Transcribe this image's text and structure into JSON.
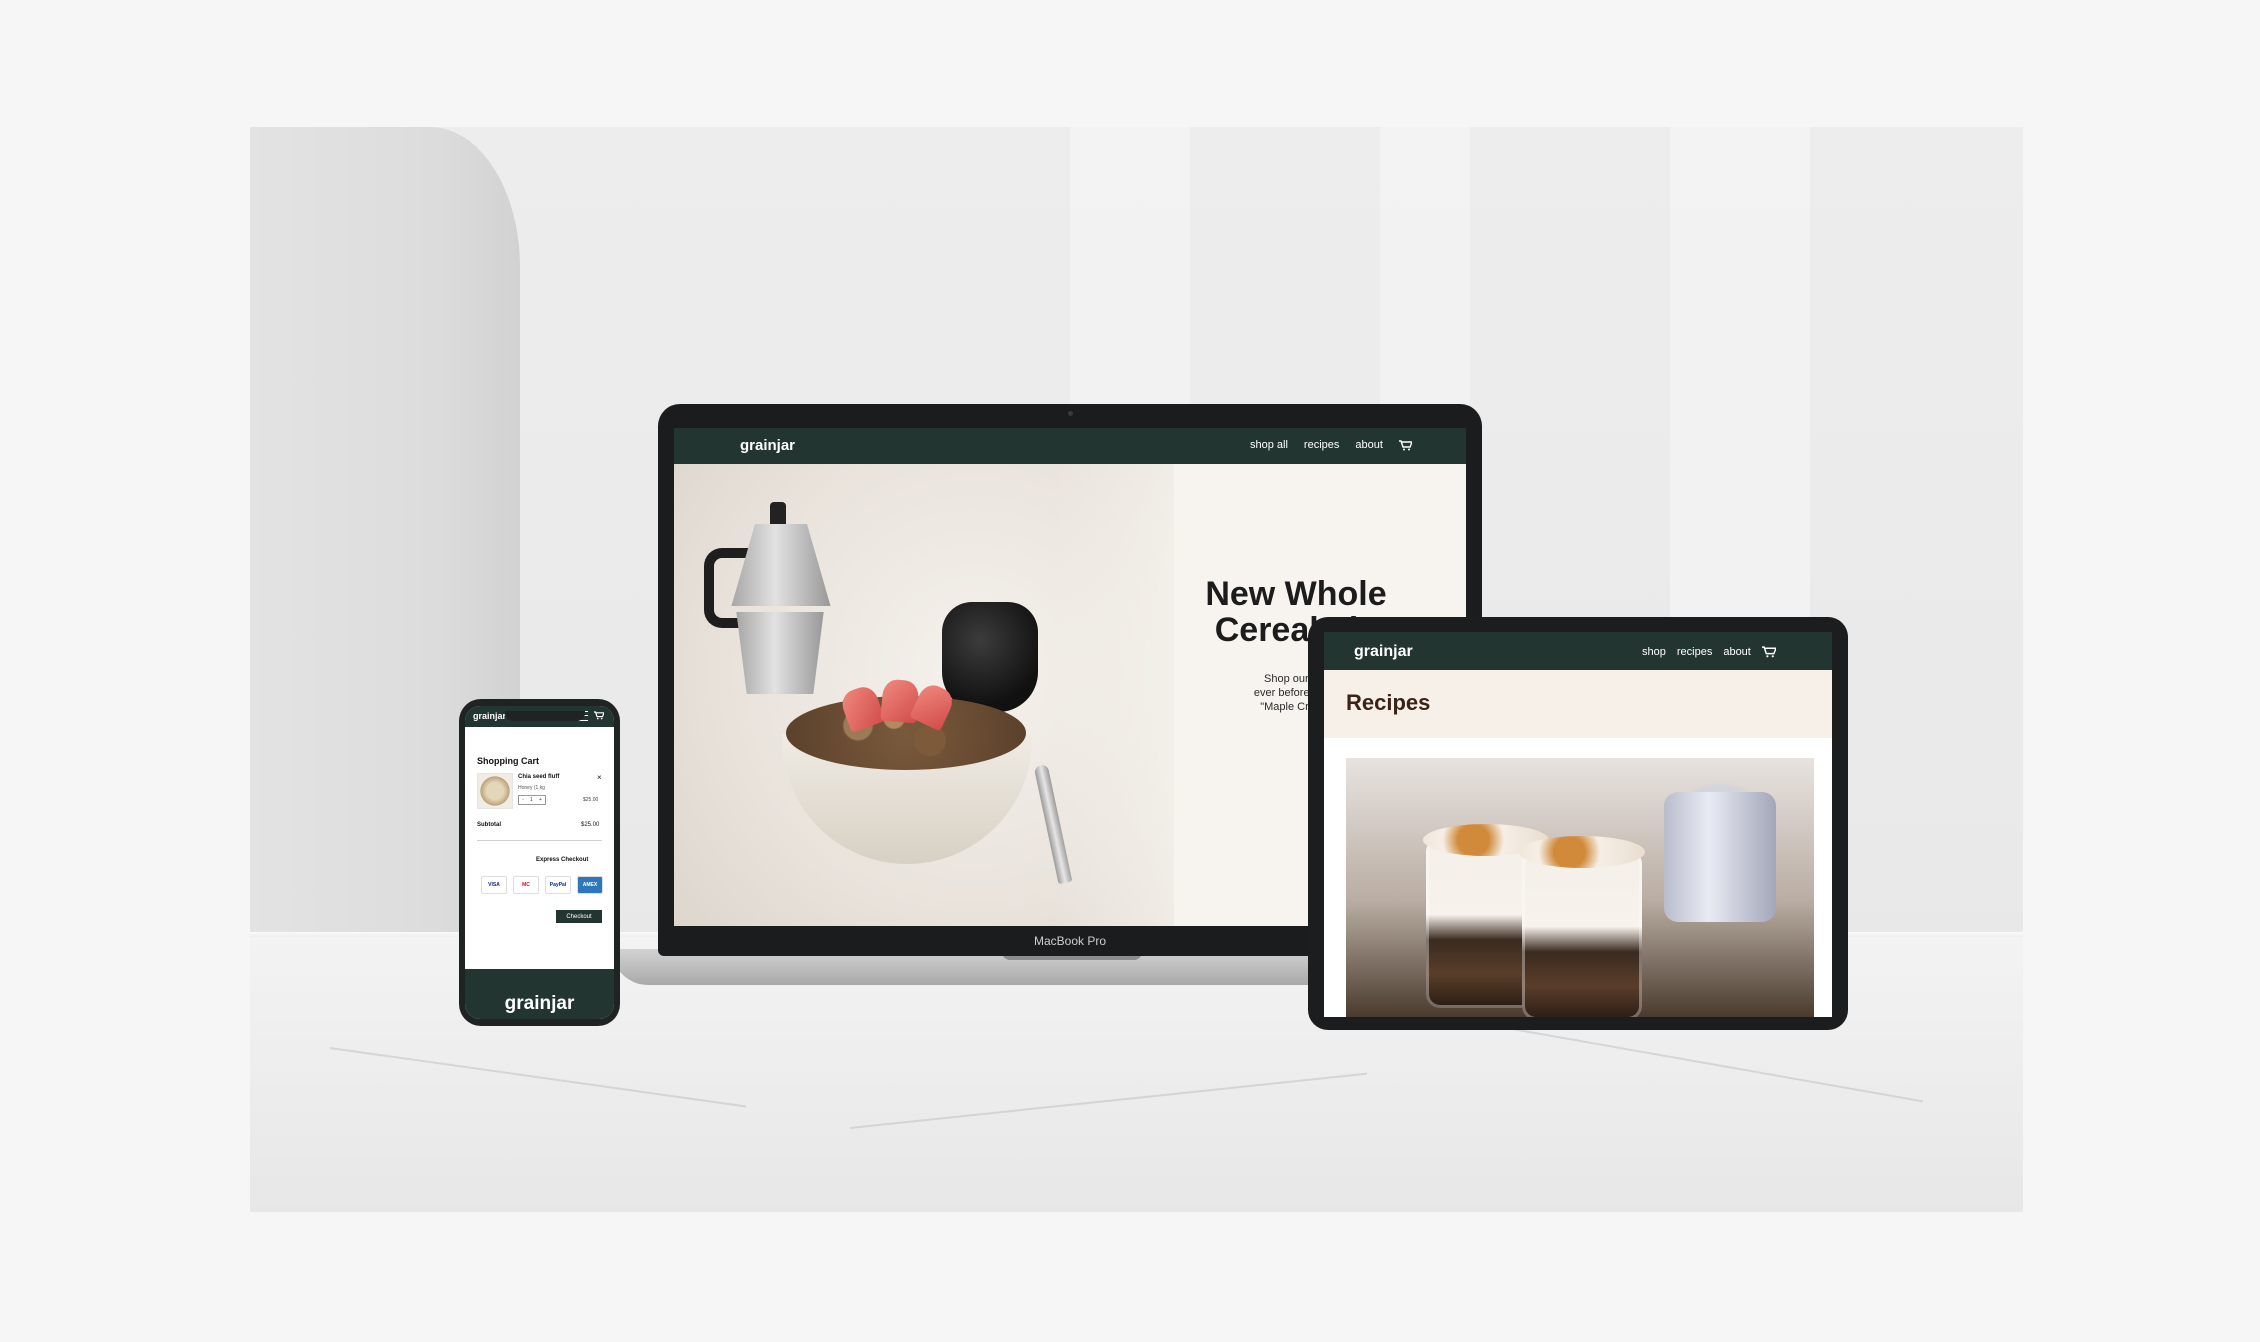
{
  "laptop": {
    "brand": "grainjar",
    "nav": [
      "shop all",
      "recipes",
      "about"
    ],
    "hero_title": "New Whole Cereal Fla",
    "hero_title_line1": "New Whole",
    "hero_title_line2": "Cereal Fla",
    "hero_sub_line1": "Shop our best-sellers",
    "hero_sub_line2": "ever before in our new fla",
    "hero_sub_line3": "\"Maple Crunch\".  Availa",
    "device_label": "MacBook Pro"
  },
  "tablet": {
    "brand": "grainjar",
    "nav": [
      "shop",
      "recipes",
      "about"
    ],
    "page_title": "Recipes"
  },
  "phone": {
    "brand": "grainjar",
    "cart_title": "Shopping Cart",
    "item_name": "Chia seed fluff",
    "item_remove": "×",
    "item_variant": "Honey (1 kg",
    "item_qty": [
      "-",
      "1",
      "+"
    ],
    "item_price": "$25.00",
    "subtotal_label": "Subtotal",
    "subtotal_value": "$25.00",
    "express_checkout": "Express Checkout",
    "cards": [
      "VISA",
      "MC",
      "PayPal",
      "AMEX"
    ],
    "checkout_label": "Checkout",
    "footer_brand": "grainjar"
  },
  "colors": {
    "brand_green": "#233530",
    "tablet_header_bg": "#f6f0e9",
    "scene_bg": "#ededed"
  }
}
